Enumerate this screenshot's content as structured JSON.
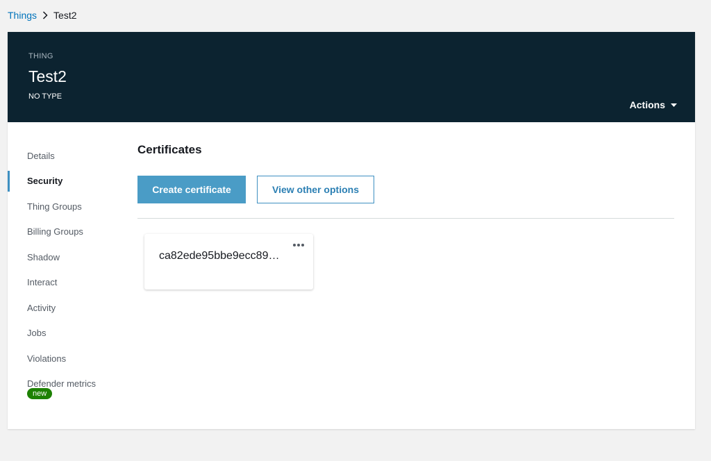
{
  "breadcrumb": {
    "root": "Things",
    "current": "Test2"
  },
  "header": {
    "eyebrow": "THING",
    "title": "Test2",
    "type": "NO TYPE",
    "actions_label": "Actions"
  },
  "nav": {
    "items": [
      {
        "label": "Details"
      },
      {
        "label": "Security"
      },
      {
        "label": "Thing Groups"
      },
      {
        "label": "Billing Groups"
      },
      {
        "label": "Shadow"
      },
      {
        "label": "Interact"
      },
      {
        "label": "Activity"
      },
      {
        "label": "Jobs"
      },
      {
        "label": "Violations"
      },
      {
        "label": "Defender metrics"
      }
    ],
    "active": "Security",
    "badge": "new"
  },
  "main": {
    "section_title": "Certificates",
    "create_button": "Create certificate",
    "options_button": "View other options",
    "certificates": [
      {
        "id": "ca82ede95bbe9ecc89…"
      }
    ]
  },
  "icons": {
    "breadcrumb_separator": "chevron-right-icon",
    "actions_caret": "caret-down-icon",
    "card_menu": "more-horizontal-icon"
  },
  "colors": {
    "header_bg": "#0c2330",
    "link": "#0073bb",
    "primary_button": "#4a9cc6",
    "active_indicator": "#3d8fc1",
    "badge": "#1d8102"
  }
}
